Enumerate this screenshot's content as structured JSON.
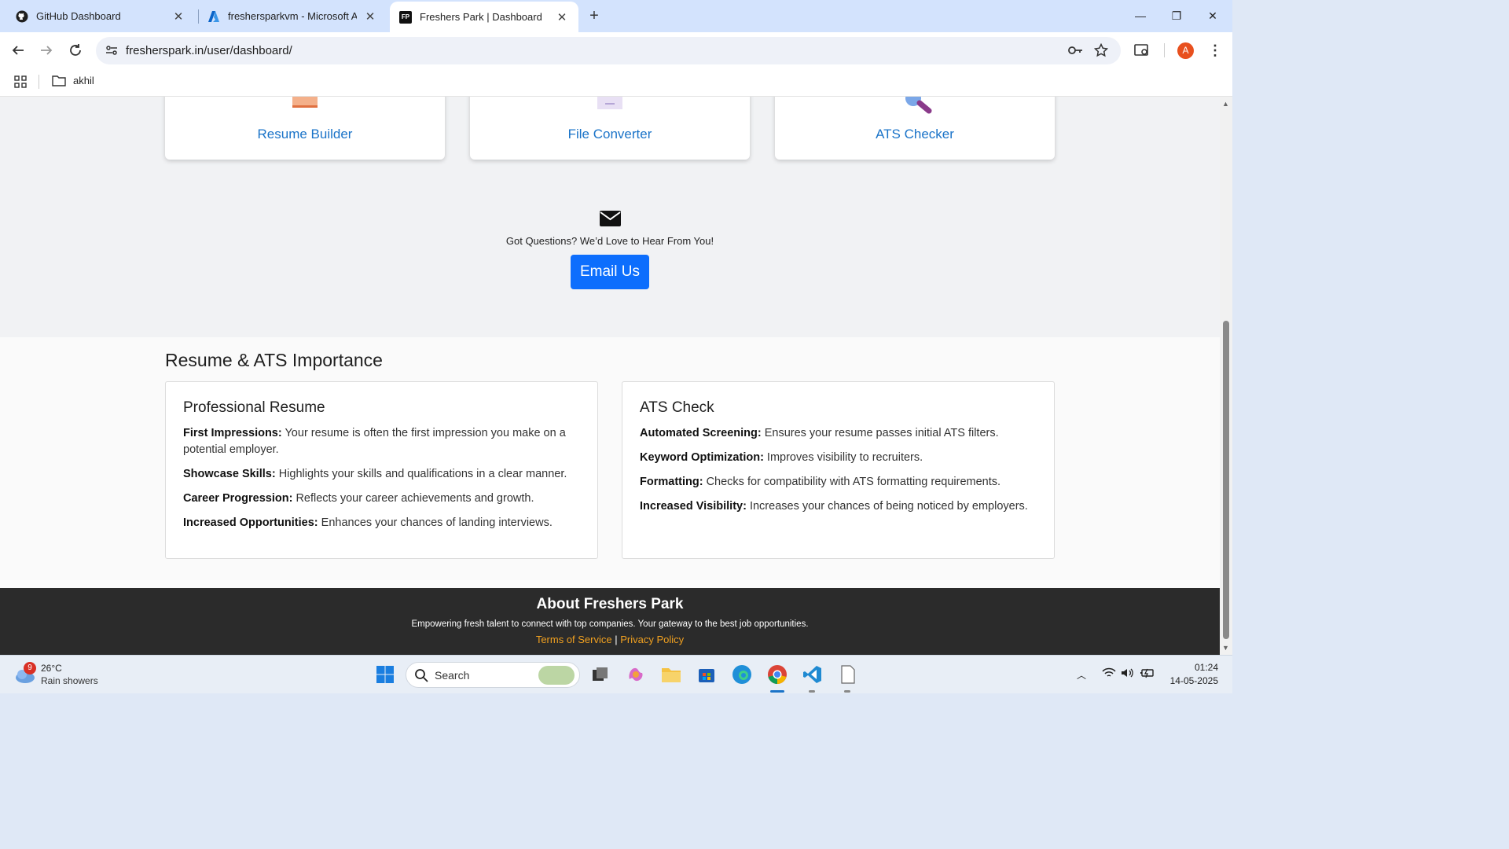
{
  "browser": {
    "tabs": [
      {
        "title": "GitHub Dashboard",
        "icon": "github-icon"
      },
      {
        "title": "freshersparkvm - Microsoft Azu",
        "icon": "azure-icon"
      },
      {
        "title": "Freshers Park | Dashboard",
        "icon": "fp-icon",
        "favicon_text": "FP",
        "active": true
      }
    ],
    "url": "fresherspark.in/user/dashboard/",
    "profile_initial": "A",
    "bookmark_folder": "akhil"
  },
  "tools": [
    {
      "label": "Resume Builder"
    },
    {
      "label": "File Converter"
    },
    {
      "label": "ATS Checker"
    }
  ],
  "contact": {
    "question": "Got Questions? We’d Love to Hear From You!",
    "button": "Email Us"
  },
  "importance": {
    "heading": "Resume & ATS Importance",
    "cards": [
      {
        "title": "Professional Resume",
        "points": [
          {
            "term": "First Impressions:",
            "text": " Your resume is often the first impression you make on a potential employer."
          },
          {
            "term": "Showcase Skills:",
            "text": " Highlights your skills and qualifications in a clear manner."
          },
          {
            "term": "Career Progression:",
            "text": " Reflects your career achievements and growth."
          },
          {
            "term": "Increased Opportunities:",
            "text": " Enhances your chances of landing interviews."
          }
        ]
      },
      {
        "title": "ATS Check",
        "points": [
          {
            "term": "Automated Screening:",
            "text": " Ensures your resume passes initial ATS filters."
          },
          {
            "term": "Keyword Optimization:",
            "text": " Improves visibility to recruiters."
          },
          {
            "term": "Formatting:",
            "text": " Checks for compatibility with ATS formatting requirements."
          },
          {
            "term": "Increased Visibility:",
            "text": " Increases your chances of being noticed by employers."
          }
        ]
      }
    ]
  },
  "footer": {
    "title": "About Freshers Park",
    "description": "Empowering fresh talent to connect with top companies. Your gateway to the best job opportunities.",
    "terms": "Terms of Service",
    "separator": "|",
    "privacy": "Privacy Policy"
  },
  "taskbar": {
    "weather_temp": "26°C",
    "weather_desc": "Rain showers",
    "weather_badge": "9",
    "search_placeholder": "Search",
    "time": "01:24",
    "date": "14-05-2025"
  },
  "colors": {
    "accent": "#0d6efd",
    "link": "#1a73c8",
    "footer_link": "#f0a020",
    "footer_bg": "#2b2b2b"
  }
}
